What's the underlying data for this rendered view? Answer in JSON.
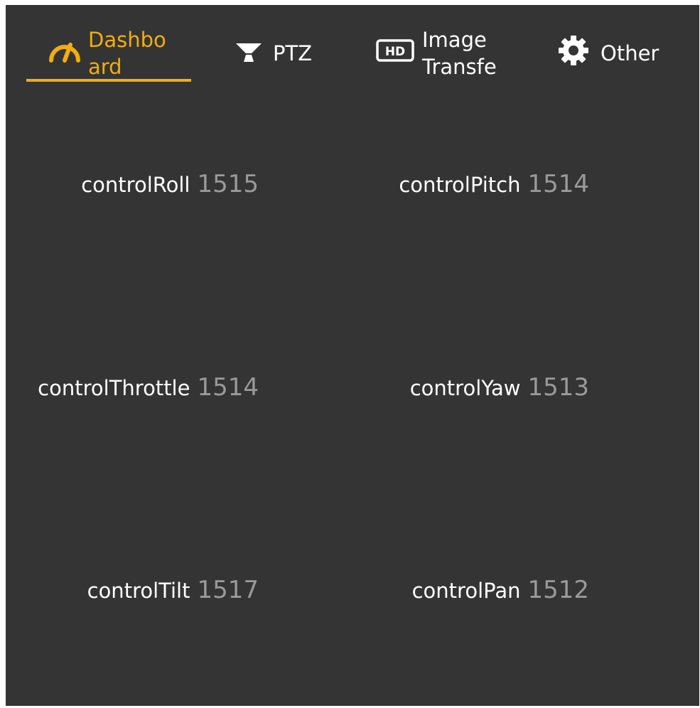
{
  "tabs": [
    {
      "label": "Dashbo ard",
      "icon": "speedometer-icon",
      "active": true
    },
    {
      "label": "PTZ",
      "icon": "gimbal-icon",
      "active": false
    },
    {
      "label": "Image Transfe",
      "icon": "hd-icon",
      "active": false
    },
    {
      "label": "Other",
      "icon": "gear-icon",
      "active": false
    }
  ],
  "controls": [
    {
      "name": "controlRoll",
      "value": "1515"
    },
    {
      "name": "controlPitch",
      "value": "1514"
    },
    {
      "name": "controlThrottle",
      "value": "1514"
    },
    {
      "name": "controlYaw",
      "value": "1513"
    },
    {
      "name": "controlTilt",
      "value": "1517"
    },
    {
      "name": "controlPan",
      "value": "1512"
    }
  ],
  "colors": {
    "background": "#343434",
    "accent": "#f2ad0e",
    "label": "#ffffff",
    "value": "#9a9a9a"
  }
}
